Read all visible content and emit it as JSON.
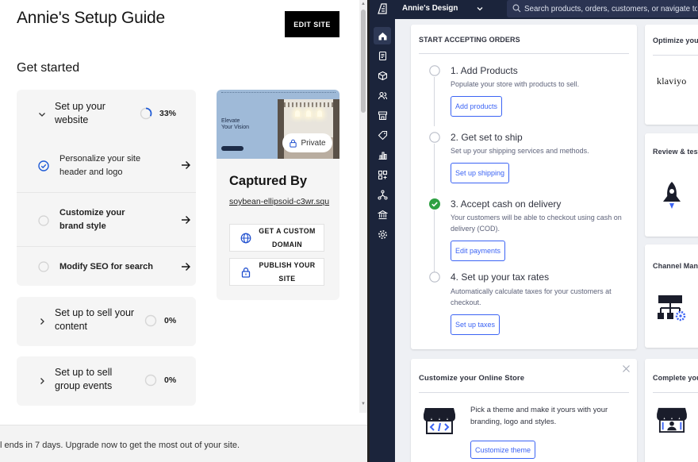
{
  "left": {
    "title": "Annie's Setup Guide",
    "edit_site_label": "EDIT SITE",
    "subtitle": "Get started",
    "sections": [
      {
        "title_lines": [
          "Set up your",
          "website"
        ],
        "percent": "33%",
        "progress": 0.33,
        "tasks": [
          {
            "label_lines": [
              "Personalize your site",
              "header and logo"
            ],
            "done": true
          },
          {
            "label_lines": [
              "Customize your",
              "brand style"
            ],
            "done": false
          },
          {
            "label_lines": [
              "Modify SEO for search"
            ],
            "done": false
          }
        ]
      },
      {
        "title_lines": [
          "Set up to sell your",
          "content"
        ],
        "percent": "0%",
        "progress": 0
      },
      {
        "title_lines": [
          "Set up to sell",
          "group events"
        ],
        "percent": "0%",
        "progress": 0
      }
    ],
    "preview": {
      "hero_lines": [
        "Elevate",
        "Your Vision"
      ],
      "private_label": "Private",
      "site_name": "Captured By",
      "site_url": "soybean-ellipsoid-c3wr.squ",
      "buttons": [
        {
          "icon": "globe-icon",
          "label_lines": [
            "GET A CUSTOM",
            "DOMAIN"
          ]
        },
        {
          "icon": "lock-icon",
          "label_lines": [
            "PUBLISH YOUR",
            "SITE"
          ]
        }
      ]
    },
    "footer_text": "l ends in 7 days. Upgrade now to get the most out of your site."
  },
  "right": {
    "store_name": "Annie's Design",
    "search_placeholder": "Search products, orders, customers, or navigate to",
    "nav_icons": [
      "home-icon",
      "orders-icon",
      "products-icon",
      "customers-icon",
      "storefront-icon",
      "marketing-icon",
      "analytics-icon",
      "apps-icon",
      "channels-icon",
      "settings-bank-icon",
      "settings-gear-icon"
    ],
    "accept_orders": {
      "heading": "START ACCEPTING ORDERS",
      "steps": [
        {
          "title": "1. Add Products",
          "desc": "Populate your store with products to sell.",
          "button": "Add products",
          "done": false
        },
        {
          "title": "2. Get set to ship",
          "desc": "Set up your shipping services and methods.",
          "button": "Set up shipping",
          "done": false
        },
        {
          "title": "3. Accept cash on delivery",
          "desc": "Your customers will be able to checkout using cash on delivery (COD).",
          "button": "Edit payments",
          "done": true
        },
        {
          "title": "4. Set up your tax rates",
          "desc": "Automatically calculate taxes for your customers at checkout.",
          "button": "Set up taxes",
          "done": false
        }
      ]
    },
    "customize": {
      "heading": "Customize your Online Store",
      "desc": "Pick a theme and make it yours with your branding, logo and styles.",
      "button": "Customize theme"
    },
    "side_cards": [
      {
        "heading": "Optimize you",
        "brand": "klaviyo"
      },
      {
        "heading": "Review & test"
      },
      {
        "heading": "Channel Mana"
      },
      {
        "heading": "Complete you"
      }
    ],
    "colors": {
      "nav_bg": "#1b243b",
      "accent": "#3c64f4",
      "success": "#2ea043"
    }
  }
}
